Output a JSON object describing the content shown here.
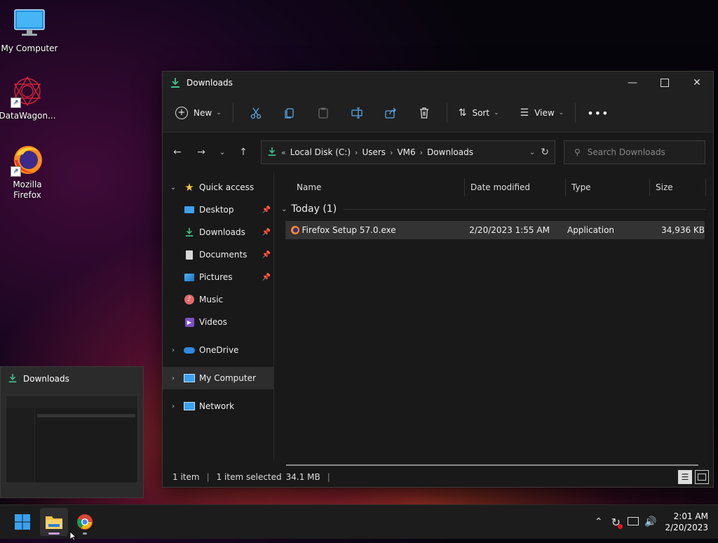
{
  "desktop": {
    "icons": [
      {
        "label": "My Computer"
      },
      {
        "label": "DataWagon..."
      },
      {
        "label": "Mozilla Firefox"
      }
    ]
  },
  "window": {
    "title": "Downloads",
    "toolbar": {
      "new_label": "New",
      "sort_label": "Sort",
      "view_label": "View"
    },
    "address": {
      "prefix": "«",
      "crumbs": [
        "Local Disk (C:)",
        "Users",
        "VM6",
        "Downloads"
      ]
    },
    "search": {
      "placeholder": "Search Downloads"
    },
    "nav": {
      "quick_access": "Quick access",
      "items": [
        "Desktop",
        "Downloads",
        "Documents",
        "Pictures",
        "Music",
        "Videos"
      ],
      "onedrive": "OneDrive",
      "my_computer": "My Computer",
      "network": "Network"
    },
    "columns": [
      "Name",
      "Date modified",
      "Type",
      "Size"
    ],
    "group": {
      "label": "Today (1)"
    },
    "files": [
      {
        "name": "Firefox Setup 57.0.exe",
        "date": "2/20/2023 1:55 AM",
        "type": "Application",
        "size": "34,936 KB"
      }
    ],
    "status": {
      "items": "1 item",
      "selected": "1 item selected",
      "size": "34.1 MB"
    }
  },
  "preview": {
    "title": "Downloads"
  },
  "taskbar": {
    "time": "2:01 AM",
    "date": "2/20/2023"
  },
  "colors": {
    "accent_green": "#3cc48a",
    "folder_yellow": "#f2c14e",
    "windows_blue": "#3aa0f0"
  }
}
